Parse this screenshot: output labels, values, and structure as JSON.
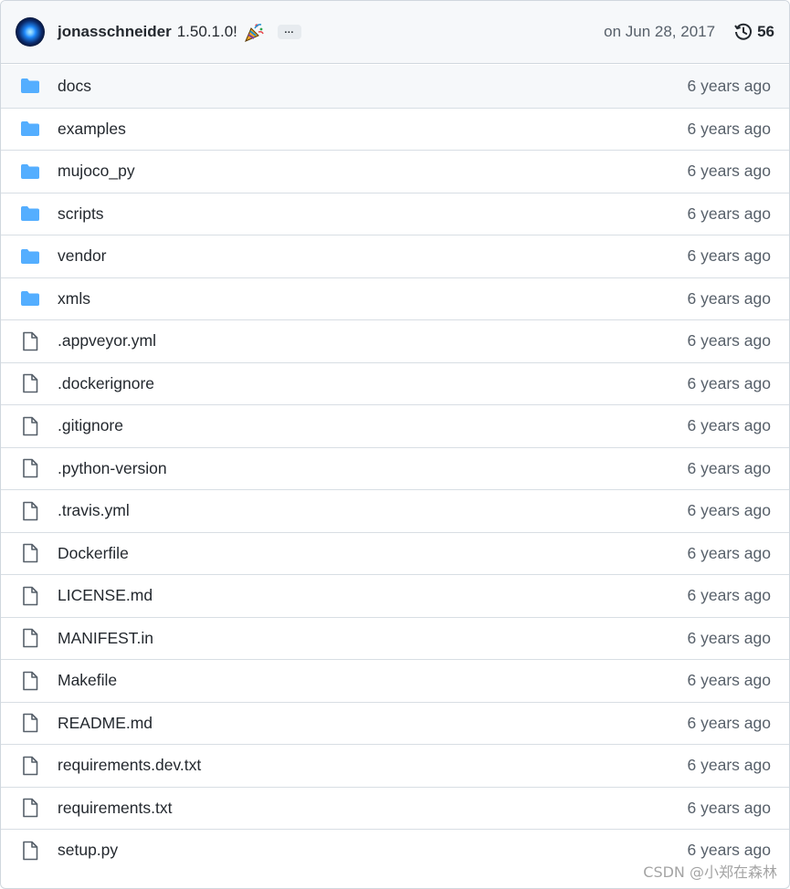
{
  "header": {
    "author": "jonasschneider",
    "commit_message": "1.50.1.0!",
    "party_icon": "party-popper-icon",
    "ellipsis": "…",
    "date": "on Jun 28, 2017",
    "history_icon": "history-icon",
    "commit_count": "56"
  },
  "files": [
    {
      "name": "docs",
      "type": "folder",
      "age": "6 years ago"
    },
    {
      "name": "examples",
      "type": "folder",
      "age": "6 years ago"
    },
    {
      "name": "mujoco_py",
      "type": "folder",
      "age": "6 years ago"
    },
    {
      "name": "scripts",
      "type": "folder",
      "age": "6 years ago"
    },
    {
      "name": "vendor",
      "type": "folder",
      "age": "6 years ago"
    },
    {
      "name": "xmls",
      "type": "folder",
      "age": "6 years ago"
    },
    {
      "name": ".appveyor.yml",
      "type": "file",
      "age": "6 years ago"
    },
    {
      "name": ".dockerignore",
      "type": "file",
      "age": "6 years ago"
    },
    {
      "name": ".gitignore",
      "type": "file",
      "age": "6 years ago"
    },
    {
      "name": ".python-version",
      "type": "file",
      "age": "6 years ago"
    },
    {
      "name": ".travis.yml",
      "type": "file",
      "age": "6 years ago"
    },
    {
      "name": "Dockerfile",
      "type": "file",
      "age": "6 years ago"
    },
    {
      "name": "LICENSE.md",
      "type": "file",
      "age": "6 years ago"
    },
    {
      "name": "MANIFEST.in",
      "type": "file",
      "age": "6 years ago"
    },
    {
      "name": "Makefile",
      "type": "file",
      "age": "6 years ago"
    },
    {
      "name": "README.md",
      "type": "file",
      "age": "6 years ago"
    },
    {
      "name": "requirements.dev.txt",
      "type": "file",
      "age": "6 years ago"
    },
    {
      "name": "requirements.txt",
      "type": "file",
      "age": "6 years ago"
    },
    {
      "name": "setup.py",
      "type": "file",
      "age": "6 years ago"
    }
  ],
  "colors": {
    "folder": "#54aeff",
    "file": "#57606a"
  },
  "watermark": "CSDN @小郑在森林"
}
